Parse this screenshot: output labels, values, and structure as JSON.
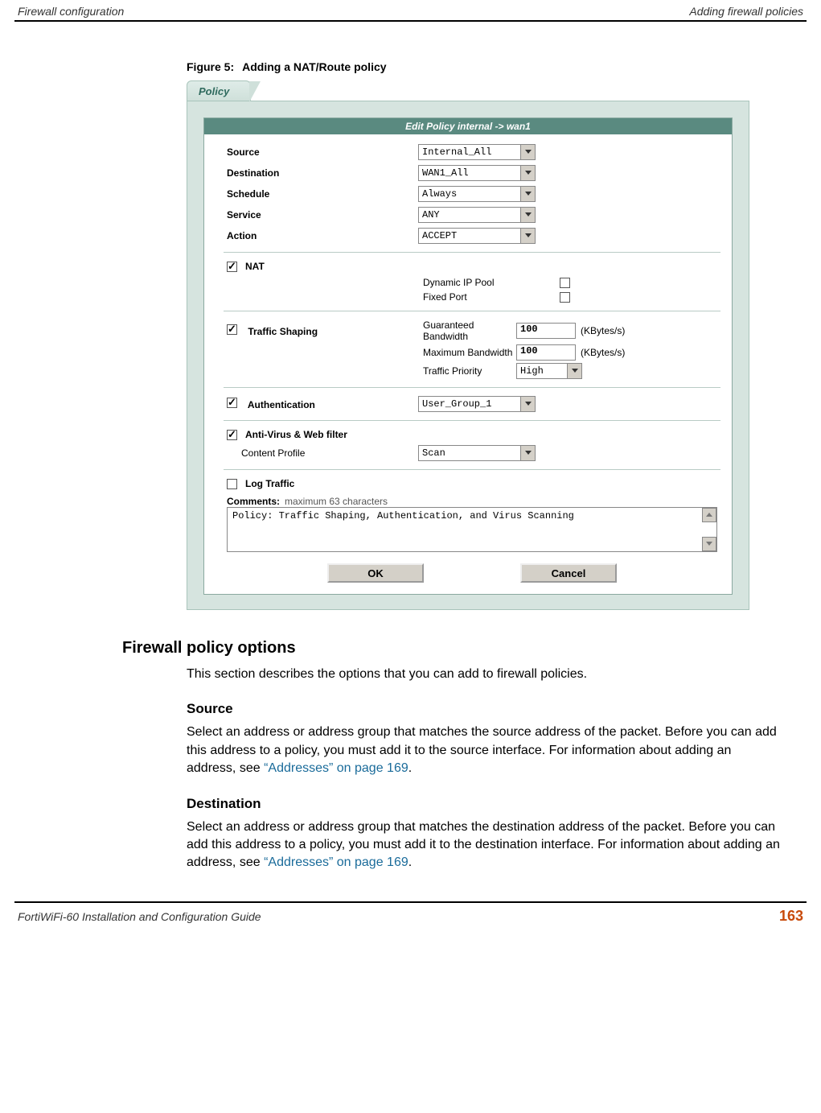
{
  "header": {
    "left": "Firewall configuration",
    "right": "Adding firewall policies"
  },
  "figure": {
    "num": "Figure 5:",
    "caption": "Adding a NAT/Route policy"
  },
  "policy": {
    "tab_label": "Policy",
    "form_title": "Edit Policy internal -> wan1",
    "rows": {
      "source_label": "Source",
      "source_value": "Internal_All",
      "destination_label": "Destination",
      "destination_value": "WAN1_All",
      "schedule_label": "Schedule",
      "schedule_value": "Always",
      "service_label": "Service",
      "service_value": "ANY",
      "action_label": "Action",
      "action_value": "ACCEPT"
    },
    "nat": {
      "label": "NAT",
      "checked": true,
      "dynamic_label": "Dynamic IP Pool",
      "dynamic_checked": false,
      "fixed_label": "Fixed Port",
      "fixed_checked": false
    },
    "traffic_shaping": {
      "label": "Traffic Shaping",
      "checked": true,
      "guaranteed_label": "Guaranteed Bandwidth",
      "guaranteed_value": "100",
      "guaranteed_unit": "(KBytes/s)",
      "maximum_label": "Maximum Bandwidth",
      "maximum_value": "100",
      "maximum_unit": "(KBytes/s)",
      "priority_label": "Traffic Priority",
      "priority_value": "High"
    },
    "auth": {
      "label": "Authentication",
      "checked": true,
      "value": "User_Group_1"
    },
    "av": {
      "label": "Anti-Virus & Web filter",
      "checked": true,
      "content_profile_label": "Content Profile",
      "content_profile_value": "Scan"
    },
    "log_traffic": {
      "label": "Log Traffic",
      "checked": false
    },
    "comments": {
      "label": "Comments:",
      "hint": "maximum 63 characters",
      "value": "Policy: Traffic Shaping, Authentication, and Virus Scanning"
    },
    "buttons": {
      "ok": "OK",
      "cancel": "Cancel"
    }
  },
  "doc": {
    "h2": "Firewall policy options",
    "intro": "This section describes the options that you can add to firewall policies.",
    "source_h": "Source",
    "source_p1": "Select an address or address group that matches the source address of the packet. Before you can add this address to a policy, you must add it to the source interface. For information about adding an address, see ",
    "source_link": "“Addresses” on page 169",
    "source_p2": ".",
    "dest_h": "Destination",
    "dest_p1": "Select an address or address group that matches the destination address of the packet. Before you can add this address to a policy, you must add it to the destination interface. For information about adding an address, see ",
    "dest_link": "“Addresses” on page 169",
    "dest_p2": "."
  },
  "footer": {
    "left": "FortiWiFi-60 Installation and Configuration Guide",
    "pagenum": "163"
  }
}
